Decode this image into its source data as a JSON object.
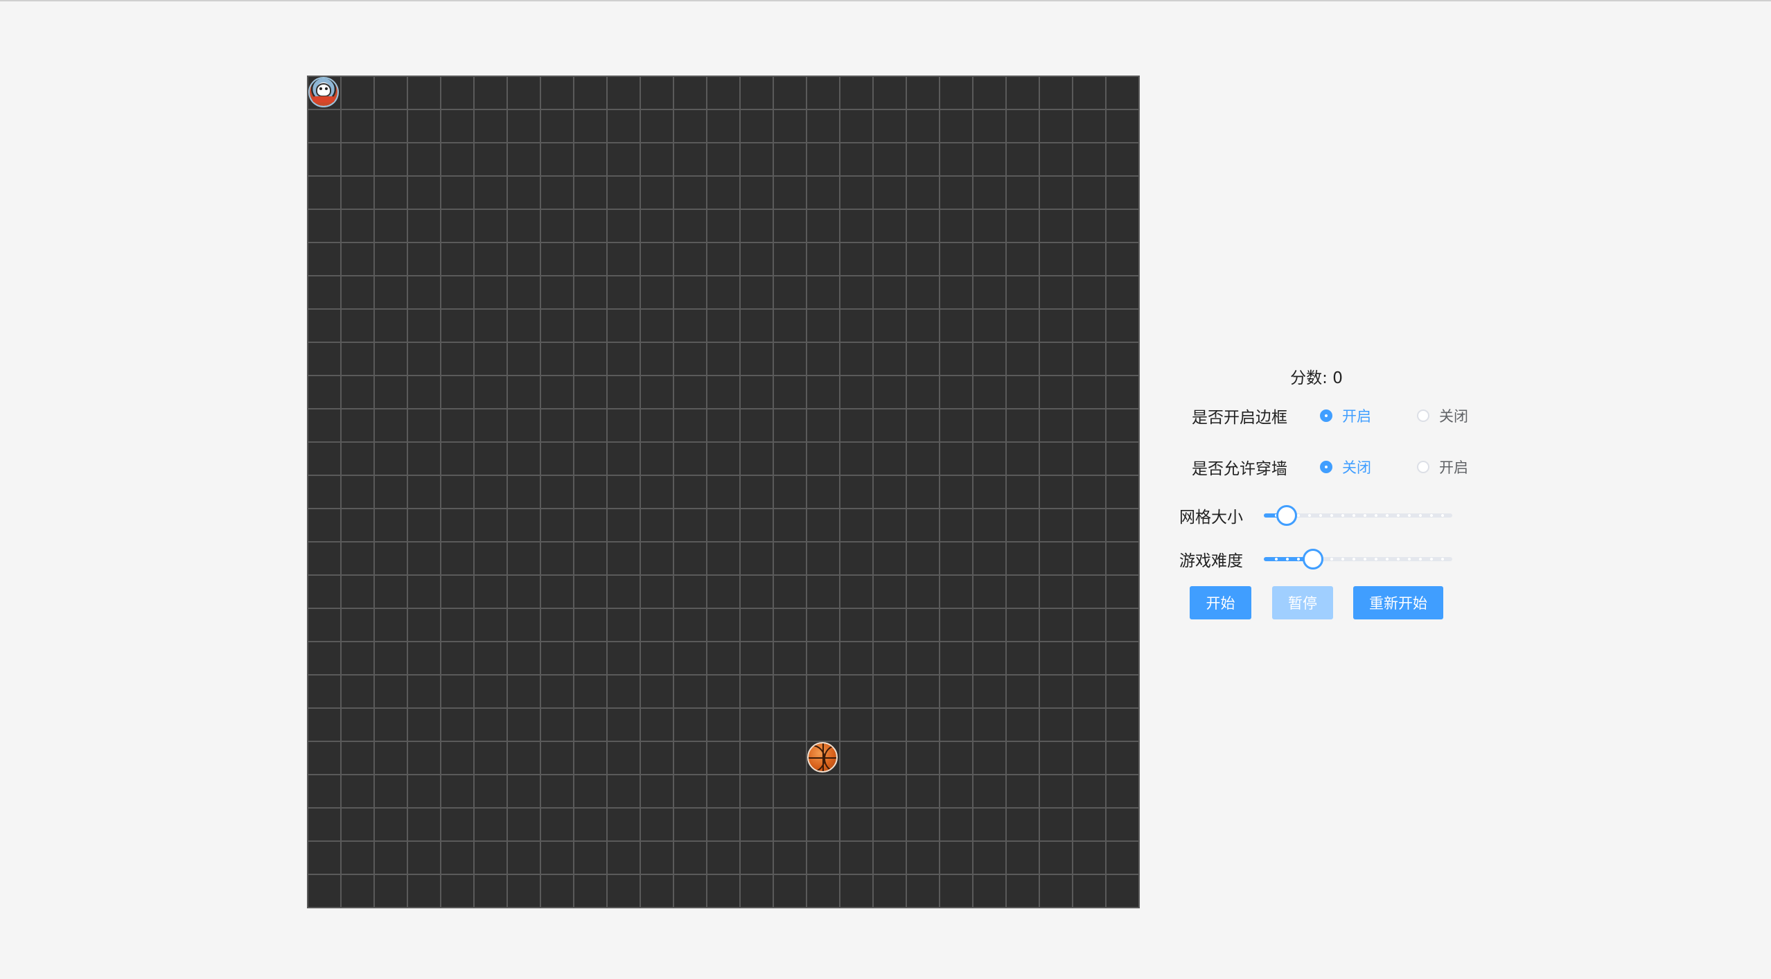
{
  "score": {
    "label": "分数:",
    "value": "0"
  },
  "options": [
    {
      "label": "是否开启边框",
      "choices": [
        {
          "text": "开启",
          "selected": true
        },
        {
          "text": "关闭",
          "selected": false
        }
      ]
    },
    {
      "label": "是否允许穿墙",
      "choices": [
        {
          "text": "关闭",
          "selected": true
        },
        {
          "text": "开启",
          "selected": false
        }
      ]
    }
  ],
  "sliders": [
    {
      "label": "网格大小",
      "value_fraction": 0.12,
      "steps": 17
    },
    {
      "label": "游戏难度",
      "value_fraction": 0.26,
      "steps": 17
    }
  ],
  "buttons": {
    "start": "开始",
    "pause": "暂停",
    "restart": "重新开始"
  },
  "game": {
    "grid": {
      "cols": 25,
      "rows": 25
    },
    "snake_head_cell": {
      "col": 0,
      "row": 0
    },
    "food_cell": {
      "col": 15,
      "row": 20
    }
  },
  "colors": {
    "board": "#2e2e2e",
    "grid_line": "#5a5a5a",
    "accent": "#409eff",
    "accent_disabled": "#a0cfff"
  },
  "icons": {
    "snake_head": "cartoon-avatar-icon",
    "food": "basketball-icon"
  }
}
